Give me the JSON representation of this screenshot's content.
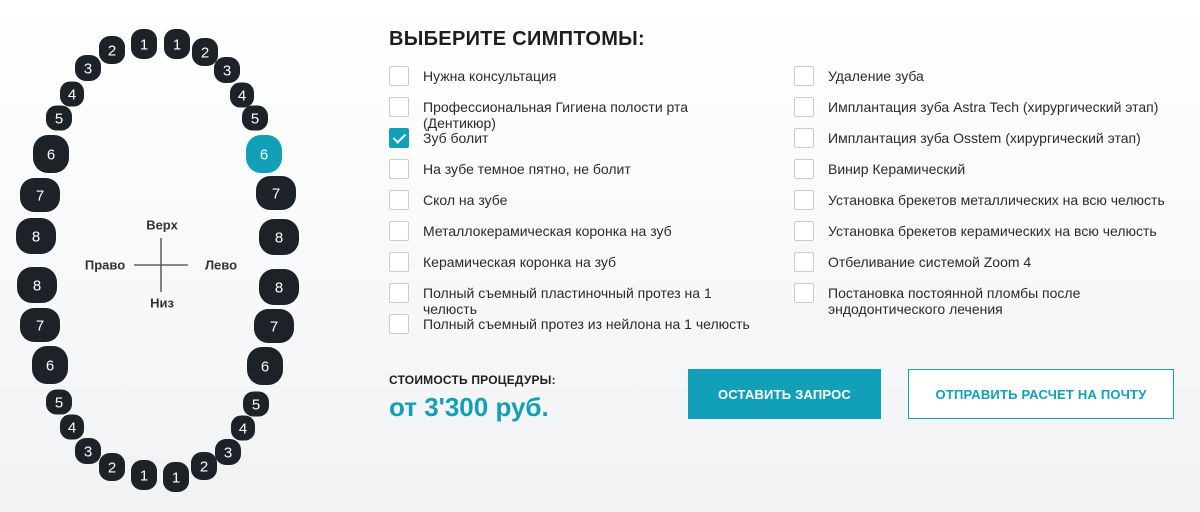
{
  "colors": {
    "accent": "#11a0b8",
    "tooth": "#1d2128",
    "tooth_selected": "#11a0b8"
  },
  "jaw": {
    "directions": {
      "up": "Верх",
      "down": "Низ",
      "left": "Право",
      "right": "Лево"
    },
    "teeth": [
      {
        "id": "ur1",
        "num": "1",
        "selected": false
      },
      {
        "id": "ur2",
        "num": "2",
        "selected": false
      },
      {
        "id": "ur3",
        "num": "3",
        "selected": false
      },
      {
        "id": "ur4",
        "num": "4",
        "selected": false
      },
      {
        "id": "ur5",
        "num": "5",
        "selected": false
      },
      {
        "id": "ur6",
        "num": "6",
        "selected": false
      },
      {
        "id": "ur7",
        "num": "7",
        "selected": false
      },
      {
        "id": "ur8",
        "num": "8",
        "selected": false
      },
      {
        "id": "ul1",
        "num": "1",
        "selected": false
      },
      {
        "id": "ul2",
        "num": "2",
        "selected": false
      },
      {
        "id": "ul3",
        "num": "3",
        "selected": false
      },
      {
        "id": "ul4",
        "num": "4",
        "selected": false
      },
      {
        "id": "ul5",
        "num": "5",
        "selected": false
      },
      {
        "id": "ul6",
        "num": "6",
        "selected": true
      },
      {
        "id": "ul7",
        "num": "7",
        "selected": false
      },
      {
        "id": "ul8",
        "num": "8",
        "selected": false
      },
      {
        "id": "lr1",
        "num": "1",
        "selected": false
      },
      {
        "id": "lr2",
        "num": "2",
        "selected": false
      },
      {
        "id": "lr3",
        "num": "3",
        "selected": false
      },
      {
        "id": "lr4",
        "num": "4",
        "selected": false
      },
      {
        "id": "lr5",
        "num": "5",
        "selected": false
      },
      {
        "id": "lr6",
        "num": "6",
        "selected": false
      },
      {
        "id": "lr7",
        "num": "7",
        "selected": false
      },
      {
        "id": "lr8",
        "num": "8",
        "selected": false
      },
      {
        "id": "ll1",
        "num": "1",
        "selected": false
      },
      {
        "id": "ll2",
        "num": "2",
        "selected": false
      },
      {
        "id": "ll3",
        "num": "3",
        "selected": false
      },
      {
        "id": "ll4",
        "num": "4",
        "selected": false
      },
      {
        "id": "ll5",
        "num": "5",
        "selected": false
      },
      {
        "id": "ll6",
        "num": "6",
        "selected": false
      },
      {
        "id": "ll7",
        "num": "7",
        "selected": false
      },
      {
        "id": "ll8",
        "num": "8",
        "selected": false
      }
    ]
  },
  "symptoms": {
    "title": "ВЫБЕРИТЕ СИМПТОМЫ:",
    "left": [
      {
        "label": "Нужна консультация",
        "checked": false
      },
      {
        "label": "Профессиональная Гигиена полости рта (Дентикюр)",
        "checked": false
      },
      {
        "label": "Зуб болит",
        "checked": true
      },
      {
        "label": "На зубе темное пятно, не болит",
        "checked": false
      },
      {
        "label": "Скол на зубе",
        "checked": false
      },
      {
        "label": "Металлокерамическая коронка на зуб",
        "checked": false
      },
      {
        "label": "Керамическая коронка на зуб",
        "checked": false
      },
      {
        "label": "Полный съемный пластиночный протез на 1 челюсть",
        "checked": false
      },
      {
        "label": "Полный съемный протез из нейлона на 1 челюсть",
        "checked": false
      }
    ],
    "right": [
      {
        "label": "Удаление зуба",
        "checked": false
      },
      {
        "label": "Имплантация зуба Astra Tech (хирургический этап)",
        "checked": false
      },
      {
        "label": "Имплантация зуба Osstem (хирургический этап)",
        "checked": false
      },
      {
        "label": "Винир Керамический",
        "checked": false
      },
      {
        "label": "Установка брекетов металлических на всю челюсть",
        "checked": false
      },
      {
        "label": "Установка брекетов керамических на всю челюсть",
        "checked": false
      },
      {
        "label": "Отбеливание системой Zoom 4",
        "checked": false
      },
      {
        "label": "Постановка постоянной пломбы после эндодонтического лечения",
        "checked": false
      }
    ]
  },
  "cost": {
    "label": "СТОИМОСТЬ ПРОЦЕДУРЫ:",
    "value": "от 3'300 руб."
  },
  "buttons": {
    "submit": "ОСТАВИТЬ ЗАПРОС",
    "email": "ОТПРАВИТЬ РАСЧЕТ НА ПОЧТУ"
  }
}
